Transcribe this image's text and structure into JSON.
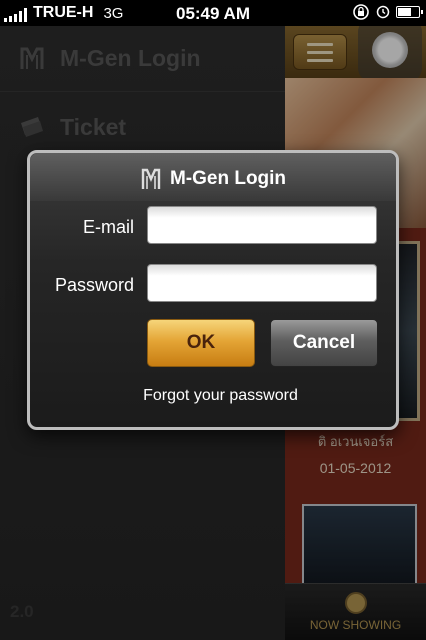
{
  "status_bar": {
    "carrier": "TRUE-H",
    "network": "3G",
    "time": "05:49 AM"
  },
  "side_menu": {
    "items": [
      {
        "label": "M-Gen Login",
        "icon": "m-gen-logo-icon"
      },
      {
        "label": "Ticket",
        "icon": "ticket-icon"
      }
    ],
    "version": "2.0"
  },
  "right_panel": {
    "movie_title": "ติ อเวนเจอร์ส",
    "date": "01-05-2012",
    "tab_label": "NOW SHOWING",
    "tab_icon": "film-reel-icon"
  },
  "dialog": {
    "title": "M-Gen Login",
    "email_label": "E-mail",
    "email_value": "",
    "password_label": "Password",
    "password_value": "",
    "ok_label": "OK",
    "cancel_label": "Cancel",
    "forgot_label": "Forgot your password"
  },
  "colors": {
    "ok_button": "#e4a536",
    "cancel_button": "#5e5e5e",
    "side_menu_bg": "#2e2e2e",
    "accent_gold": "#b99a54"
  }
}
